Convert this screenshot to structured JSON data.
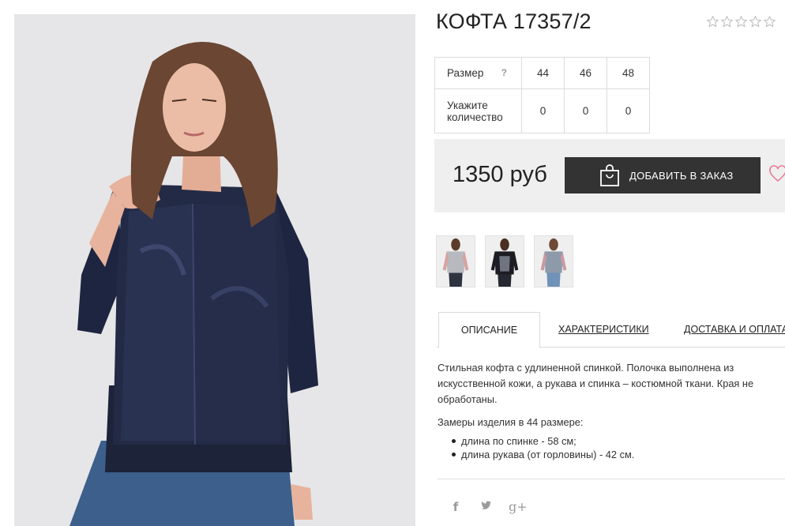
{
  "product": {
    "title": "КОФТА 17357/2",
    "rating_stars": 5,
    "rating_filled": 0,
    "price": "1350 руб"
  },
  "sizes_table": {
    "row1_label": "Размер",
    "help_mark": "?",
    "sizes": [
      "44",
      "46",
      "48"
    ],
    "row2_label": "Укажите количество",
    "quantities": [
      "0",
      "0",
      "0"
    ]
  },
  "actions": {
    "order_label": "ДОБАВИТЬ В ЗАКАЗ",
    "favorite_icon": "heart-icon",
    "bag_icon": "shopping-bag-icon"
  },
  "tabs": {
    "description": "ОПИСАНИЕ",
    "characteristics": "ХАРАКТЕРИСТИКИ",
    "delivery": "ДОСТАВКА И ОПЛАТА"
  },
  "description": {
    "paragraph": "Стильная кофта с удлиненной спинкой. Полочка выполнена из искусственной кожи, а рукава и спинка – костюмной ткани. Края не обработаны.",
    "measures_title": "Замеры изделия в 44 размере:",
    "measures": [
      "длина по спинке - 58 см;",
      "длина рукава (от горловины) - 42 см."
    ]
  },
  "social": {
    "facebook": "f",
    "twitter": "t",
    "google_plus": "g+"
  },
  "colors": {
    "button_bg": "#333333",
    "buybox_bg": "#efefef",
    "heart": "#e87d97",
    "icon_grey": "#9a9a9a"
  }
}
